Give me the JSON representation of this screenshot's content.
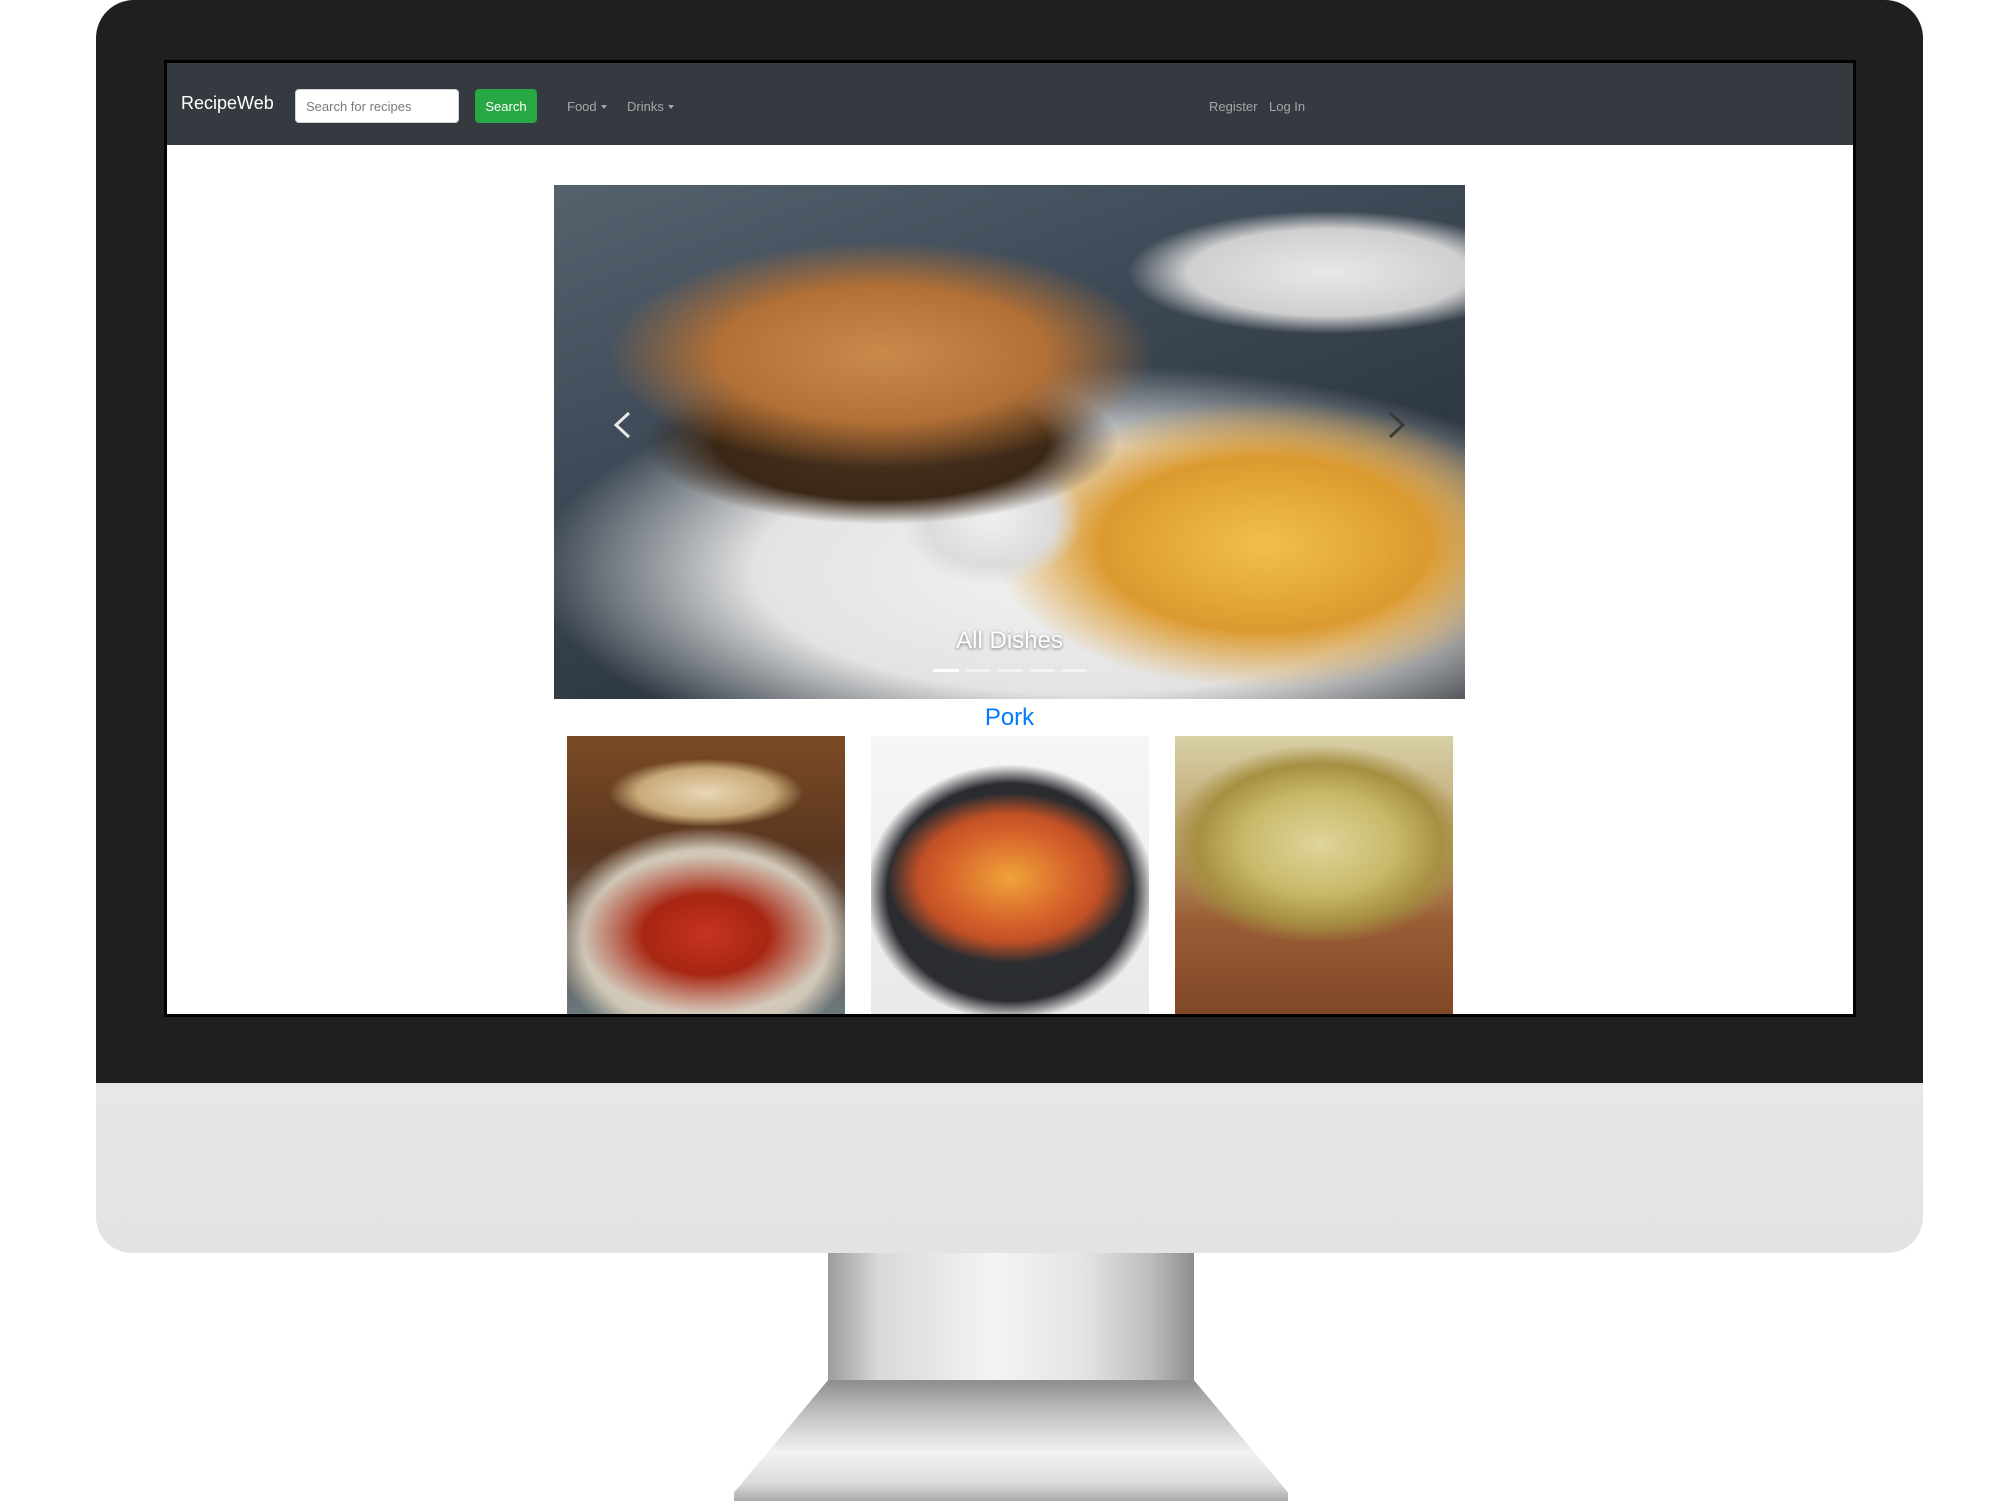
{
  "navbar": {
    "brand": "RecipeWeb",
    "search": {
      "placeholder": "Search for recipes",
      "value": ""
    },
    "search_button_label": "Search",
    "menu": [
      {
        "label": "Food",
        "dropdown": true
      },
      {
        "label": "Drinks",
        "dropdown": true
      }
    ],
    "auth": [
      {
        "label": "Register"
      },
      {
        "label": "Log In"
      }
    ]
  },
  "carousel": {
    "caption": "All Dishes",
    "slides_count": 5,
    "active_slide": 1
  },
  "section": {
    "title": "Pork",
    "cards": [
      {
        "image": "sweet-and-sour-pork-photo"
      },
      {
        "image": "hot-and-sour-soup-photo"
      },
      {
        "image": "vegetable-frittata-photo"
      }
    ]
  },
  "colors": {
    "navbar_bg": "#343a40",
    "search_button": "#28a745",
    "link_blue": "#007bff",
    "bezel": "#1f1f1f",
    "chin": "#e4e5e4"
  }
}
